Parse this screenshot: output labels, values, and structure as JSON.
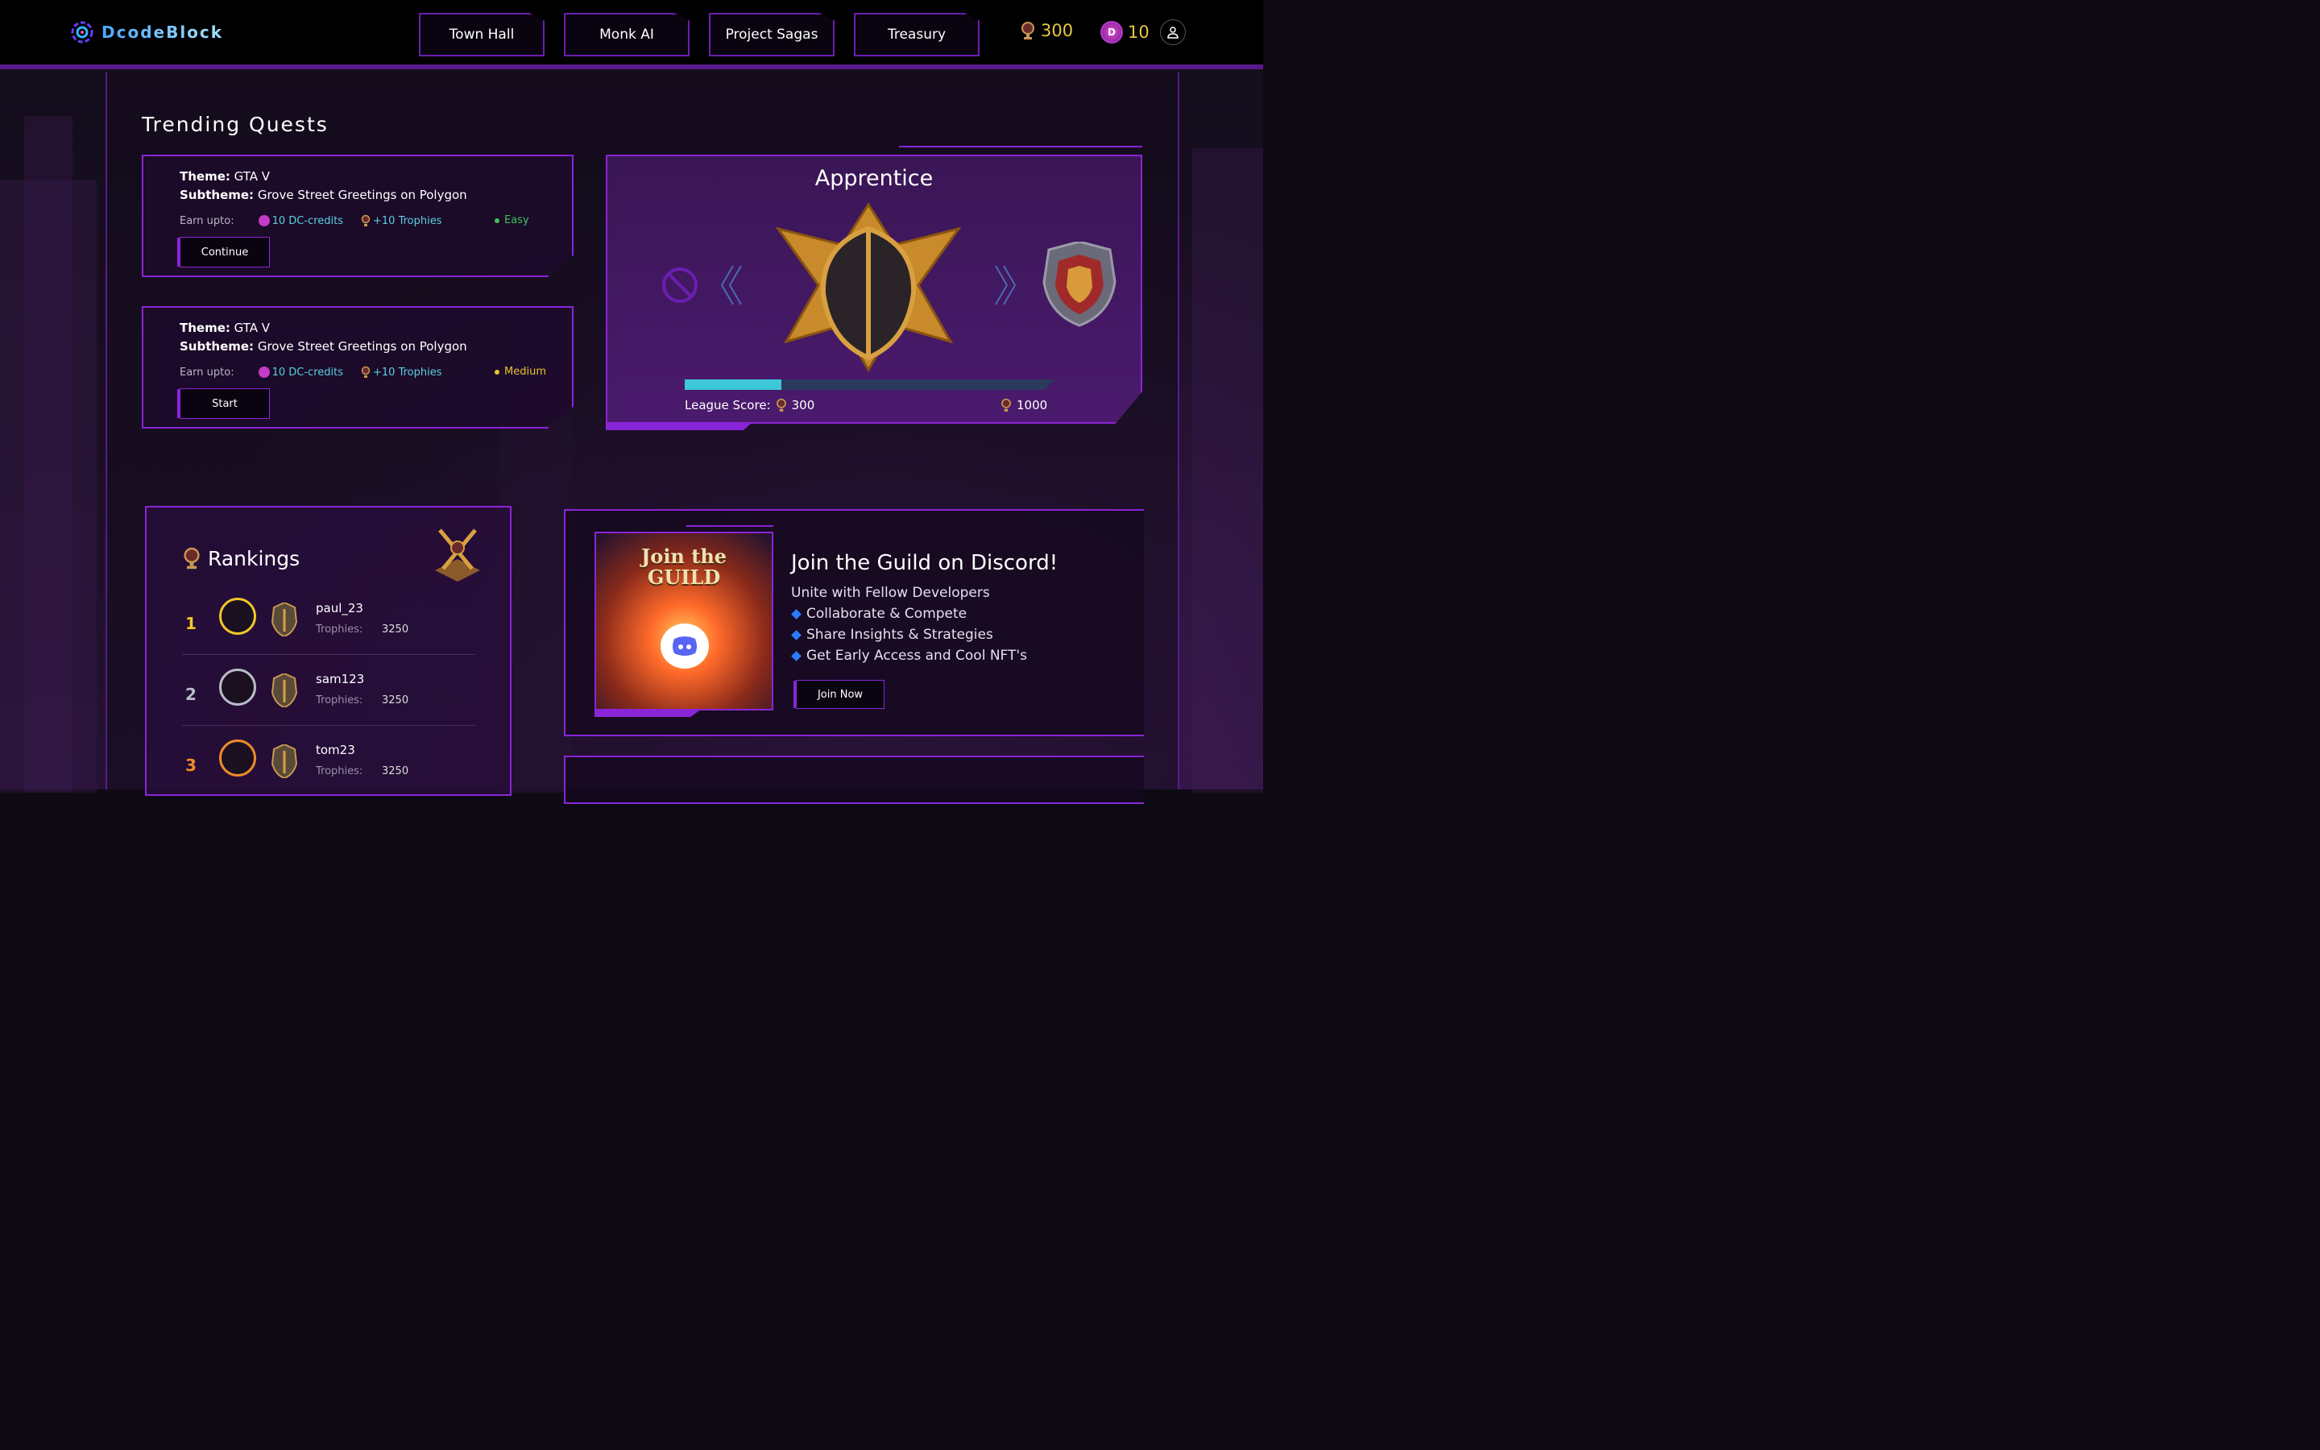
{
  "brand": {
    "name": "DcodeBlock"
  },
  "nav": {
    "items": [
      {
        "label": "Town Hall"
      },
      {
        "label": "Monk AI"
      },
      {
        "label": "Project Sagas"
      },
      {
        "label": "Treasury"
      }
    ],
    "trophies": "300",
    "credits": "10",
    "icons": {
      "trophy": "trophy-icon",
      "credit": "dc-credit-icon",
      "user": "user-icon"
    }
  },
  "quests": {
    "title": "Trending Quests",
    "theme_label": "Theme:",
    "subtheme_label": "Subtheme:",
    "earn_label": "Earn upto:",
    "items": [
      {
        "theme": "GTA V",
        "subtheme": "Grove Street Greetings on Polygon",
        "credits": "10 DC-credits",
        "trophies": "+10 Trophies",
        "difficulty": "Easy",
        "difficulty_color": "#3ec25a",
        "action": "Continue"
      },
      {
        "theme": "GTA V",
        "subtheme": "Grove Street Greetings on Polygon",
        "credits": "10 DC-credits",
        "trophies": "+10 Trophies",
        "difficulty": "Medium",
        "difficulty_color": "#e6c230",
        "action": "Start"
      }
    ]
  },
  "league": {
    "title": "Apprentice",
    "score_label": "League Score:",
    "score": "300",
    "max": "1000",
    "progress": 0.26
  },
  "rankings": {
    "title": "Rankings",
    "trophies_label": "Trophies:",
    "rows": [
      {
        "rank": "1",
        "name": "paul_23",
        "trophies": "3250",
        "color": "#f2c52a"
      },
      {
        "rank": "2",
        "name": "sam123",
        "trophies": "3250",
        "color": "#b8bcc8"
      },
      {
        "rank": "3",
        "name": "tom23",
        "trophies": "3250",
        "color": "#f08a2a"
      }
    ]
  },
  "guild": {
    "image_text_line1": "Join the",
    "image_text_line2": "GUILD",
    "title": "Join the Guild on Discord!",
    "subtitle": "Unite with Fellow Developers",
    "bullets": [
      "Collaborate & Compete",
      "Share Insights & Strategies",
      "Get Early Access and Cool NFT's"
    ],
    "button": "Join Now"
  }
}
